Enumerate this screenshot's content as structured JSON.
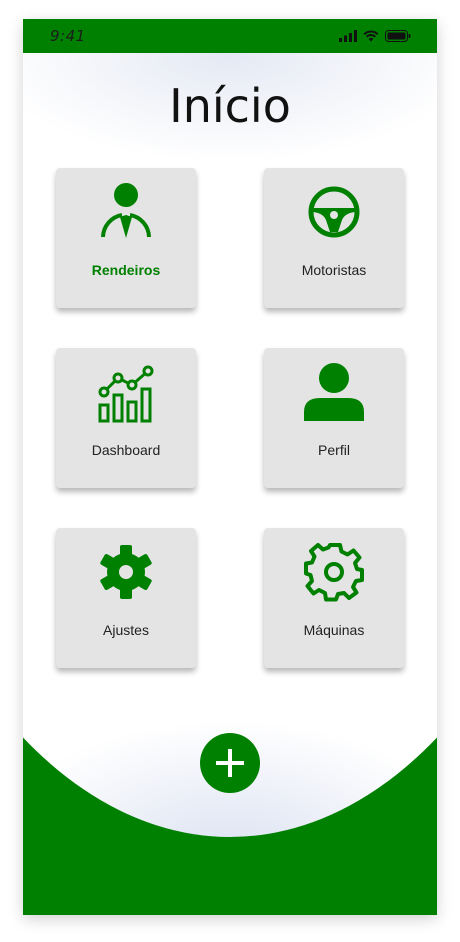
{
  "status_bar": {
    "time": "9:41"
  },
  "page": {
    "title": "Início"
  },
  "menu": {
    "items": [
      {
        "label": "Rendeiros",
        "icon": "farmer-icon",
        "active": true
      },
      {
        "label": "Motoristas",
        "icon": "steering-wheel-icon",
        "active": false
      },
      {
        "label": "Dashboard",
        "icon": "chart-icon",
        "active": false
      },
      {
        "label": "Perfil",
        "icon": "user-icon",
        "active": false
      },
      {
        "label": "Ajustes",
        "icon": "gear-filled-icon",
        "active": false
      },
      {
        "label": "Máquinas",
        "icon": "gear-outline-icon",
        "active": false
      }
    ]
  },
  "fab": {
    "icon": "plus-icon"
  },
  "colors": {
    "primary": "#008000",
    "card_bg": "#e4e4e4"
  }
}
